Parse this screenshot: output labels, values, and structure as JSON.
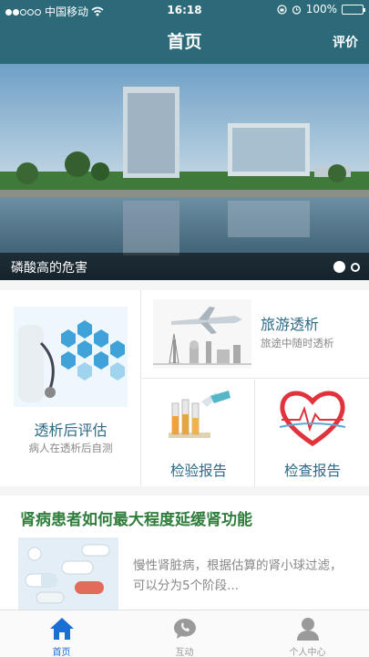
{
  "status_bar": {
    "carrier": "中国移动",
    "time": "16:18",
    "battery": "100%"
  },
  "nav": {
    "title": "首页",
    "action": "评价"
  },
  "banner": {
    "caption": "磷酸高的危害",
    "page_count": 2,
    "active_page": 1
  },
  "features": {
    "assessment": {
      "title": "透析后评估",
      "subtitle": "病人在透析后自测"
    },
    "travel": {
      "title": "旅游透析",
      "subtitle": "旅途中随时透析"
    },
    "lab_report": {
      "title": "检验报告"
    },
    "check_report": {
      "title": "检查报告"
    }
  },
  "article": {
    "title": "肾病患者如何最大程度延缓肾功能",
    "summary": "慢性肾脏病，根据估算的肾小球过滤，可以分为5个阶段..."
  },
  "tabbar": {
    "items": [
      {
        "label": "首页",
        "icon": "home-icon",
        "active": true
      },
      {
        "label": "互动",
        "icon": "chat-icon",
        "active": false
      },
      {
        "label": "个人中心",
        "icon": "person-icon",
        "active": false
      }
    ]
  },
  "colors": {
    "nav_bg": "#2c6a7a",
    "feature_text": "#2d6a86",
    "article_title": "#2e7d3c",
    "tab_active": "#1a6fd6"
  }
}
